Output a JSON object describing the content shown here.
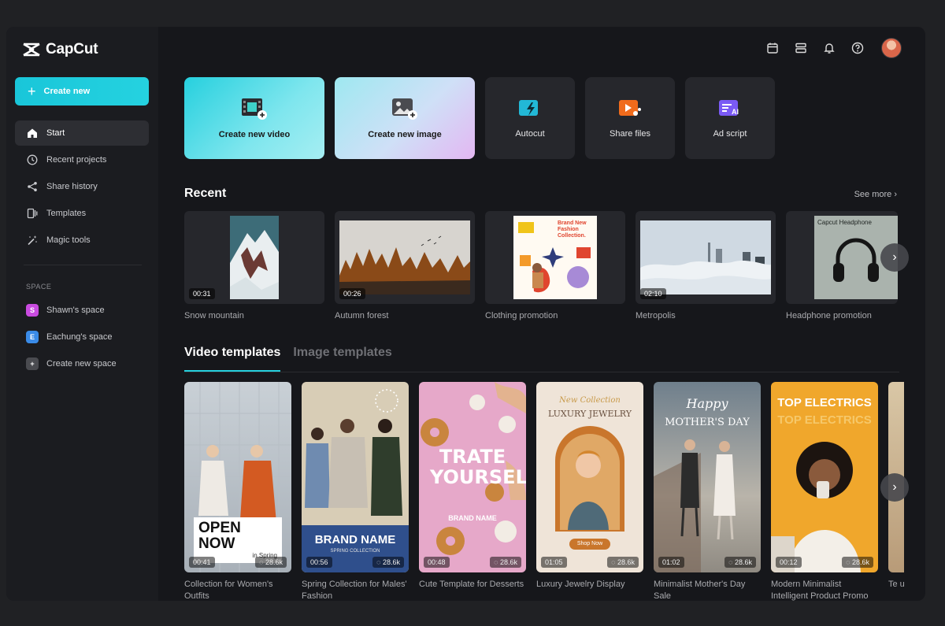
{
  "app": {
    "name": "CapCut"
  },
  "sidebar": {
    "create_label": "Create new",
    "items": [
      {
        "label": "Start"
      },
      {
        "label": "Recent projects"
      },
      {
        "label": "Share history"
      },
      {
        "label": "Templates"
      },
      {
        "label": "Magic tools"
      }
    ],
    "space_heading": "SPACE",
    "spaces": [
      {
        "badge": "S",
        "label": "Shawn's space",
        "color": "#c94be0"
      },
      {
        "badge": "E",
        "label": "Eachung's space",
        "color": "#3a8be8"
      },
      {
        "badge": "+",
        "label": "Create new space",
        "color": "#4a4b50"
      }
    ]
  },
  "quick_actions": [
    {
      "label": "Create new video",
      "icon": "film-plus-icon"
    },
    {
      "label": "Create new image",
      "icon": "image-plus-icon"
    },
    {
      "label": "Autocut",
      "icon": "autocut-icon"
    },
    {
      "label": "Share files",
      "icon": "share-files-icon"
    },
    {
      "label": "Ad script",
      "icon": "ad-script-icon"
    }
  ],
  "recent": {
    "title": "Recent",
    "see_more": "See more",
    "items": [
      {
        "label": "Snow mountain",
        "duration": "00:31"
      },
      {
        "label": "Autumn forest",
        "duration": "00:26"
      },
      {
        "label": "Clothing promotion",
        "duration": ""
      },
      {
        "label": "Metropolis",
        "duration": "02:10"
      },
      {
        "label": "Headphone promotion",
        "duration": ""
      }
    ],
    "clothing_thumb_text": "Brand New Fashion Collection.",
    "headphone_thumb_text": "Capcut Headphone"
  },
  "tabs": [
    {
      "label": "Video templates",
      "active": true
    },
    {
      "label": "Image templates",
      "active": false
    }
  ],
  "templates": [
    {
      "label": "Collection for Women's Outfits",
      "duration": "00:41",
      "uses": "28.6k",
      "overlay": "OPEN NOW",
      "sub": "in Spring"
    },
    {
      "label": "Spring Collection for Males' Fashion",
      "duration": "00:56",
      "uses": "28.6k",
      "overlay": "BRAND NAME",
      "sub": "SPRING COLLECTION"
    },
    {
      "label": "Cute Template for Desserts",
      "duration": "00:48",
      "uses": "28.6k",
      "overlay": "TRATE YOURSELF",
      "sub": "BRAND NAME"
    },
    {
      "label": "Luxury Jewelry Display",
      "duration": "01:05",
      "uses": "28.6k",
      "overlay": "LUXURY JEWELRY",
      "sub": "New Collection",
      "button": "Shop Now"
    },
    {
      "label": "Minimalist Mother's Day Sale",
      "duration": "01:02",
      "uses": "28.6k",
      "overlay": "MOTHER'S DAY",
      "sub": "Happy"
    },
    {
      "label": "Modern Minimalist Intelligent Product Promo",
      "duration": "00:12",
      "uses": "28.6k",
      "overlay": "TOP ELECTRICS",
      "sub": "TOP ELECTRICS"
    }
  ],
  "peek_label": "Te up"
}
